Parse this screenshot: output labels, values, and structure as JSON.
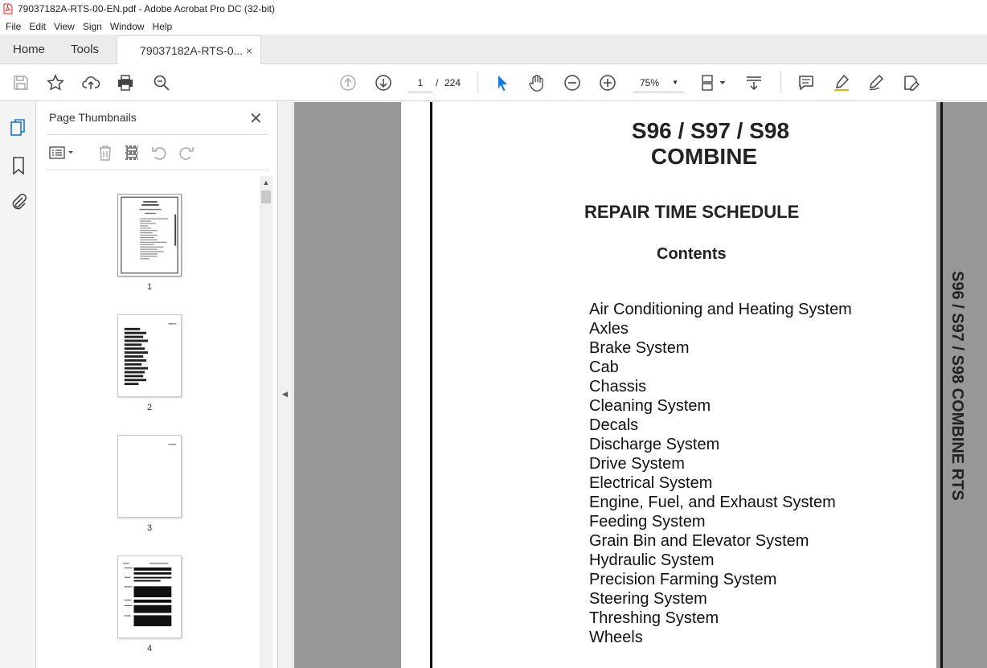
{
  "window": {
    "title": "79037182A-RTS-00-EN.pdf - Adobe Acrobat Pro DC (32-bit)"
  },
  "menu": [
    "File",
    "Edit",
    "View",
    "Sign",
    "Window",
    "Help"
  ],
  "tabs": {
    "home": "Home",
    "tools": "Tools",
    "document": "79037182A-RTS-0...",
    "close": "×"
  },
  "toolbar": {
    "page_current": "1",
    "page_sep": "/",
    "page_total": "224",
    "zoom": "75%",
    "icons": [
      "save-icon",
      "bookmark-star-icon",
      "upload-icon",
      "print-icon",
      "search-icon",
      "prev-page-icon",
      "next-page-icon",
      "select-cursor-icon",
      "hand-icon",
      "zoom-out-icon",
      "zoom-in-icon",
      "page-fit-icon",
      "scroll-mode-icon",
      "comment-icon",
      "highlight-icon",
      "sign-icon",
      "edit-pdf-icon"
    ]
  },
  "panel": {
    "title": "Page Thumbnails",
    "close": "✕",
    "thumbnails": [
      "1",
      "2",
      "3",
      "4"
    ]
  },
  "document": {
    "title_line1": "S96 / S97 / S98",
    "title_line2": "COMBINE",
    "subtitle": "REPAIR TIME SCHEDULE",
    "contents_heading": "Contents",
    "toc": [
      "Air Conditioning and Heating System",
      "Axles",
      "Brake System",
      "Cab",
      "Chassis",
      "Cleaning System",
      "Decals",
      "Discharge System",
      "Drive System",
      "Electrical System",
      "Engine, Fuel, and Exhaust System",
      "Feeding System",
      "Grain Bin and Elevator System",
      "Hydraulic System",
      "Precision Farming System",
      "Steering System",
      "Threshing System",
      "Wheels"
    ],
    "side_label": "S96 / S97 / S98 COMBINE RTS"
  },
  "colors": {
    "accent": "#1473e6",
    "viewer_bg": "#979797",
    "panel_bg": "#f4f4f4"
  }
}
